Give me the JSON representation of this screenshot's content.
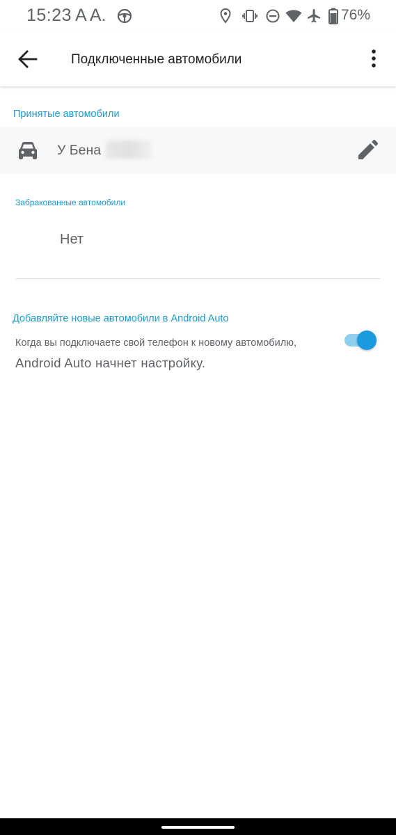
{
  "status_bar": {
    "time": "15:23",
    "extra": "A A.",
    "battery_percent": "76%",
    "icons": [
      "steering-wheel-icon",
      "location-icon",
      "vibrate-icon",
      "do-not-disturb-icon",
      "wifi-icon",
      "airplane-icon",
      "battery-icon"
    ]
  },
  "app_bar": {
    "title": "Подключенные автомобили",
    "back_icon": "arrow-back-icon",
    "menu_icon": "more-vert-icon"
  },
  "accepted": {
    "header": "Принятые автомобили",
    "cars": [
      {
        "name": "У Бена",
        "icon": "car-icon",
        "action_icon": "edit-icon"
      }
    ]
  },
  "rejected": {
    "header": "Забракованные автомобили",
    "empty_text": "Нет"
  },
  "add_new": {
    "header": "Добавляйте новые автомобили в Android Auto",
    "description_line1": "Когда вы подключаете свой телефон к новому автомобилю,",
    "description_line2": "Android Auto начнет настройку.",
    "enabled": true
  },
  "colors": {
    "accent": "#1a9bd0",
    "toggle_thumb": "#1a9be0",
    "toggle_track": "#8fd0ef",
    "text_secondary": "#5f6368"
  }
}
